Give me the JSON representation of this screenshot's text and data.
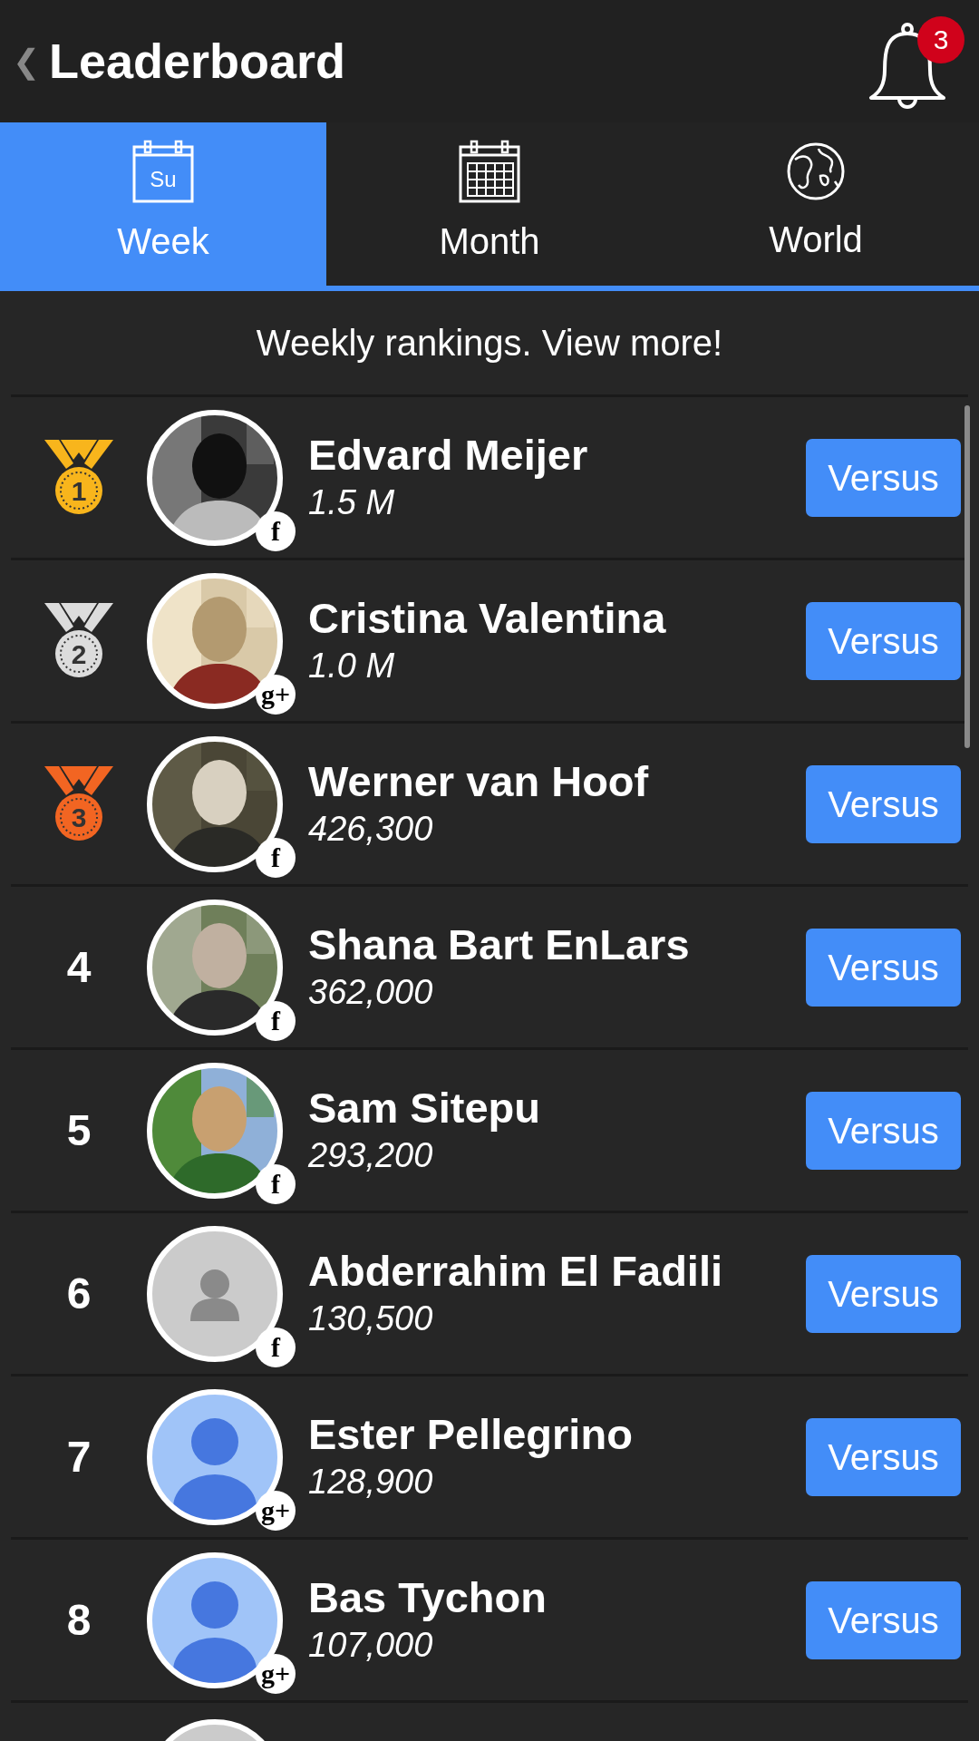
{
  "header": {
    "back": "❮",
    "title": "Leaderboard",
    "notification_count": "3"
  },
  "tabs": [
    {
      "label": "Week",
      "kind": "week",
      "icon_text": "Su",
      "selected": true
    },
    {
      "label": "Month",
      "kind": "month",
      "selected": false
    },
    {
      "label": "World",
      "kind": "globe",
      "selected": false
    }
  ],
  "subtitle": "Weekly rankings. View more!",
  "rows": [
    {
      "rank": "1",
      "kind": "medal",
      "color": "#f8b51c",
      "network": "f",
      "name": "Edvard Meijer",
      "score": "1.5 M",
      "button": "Versus"
    },
    {
      "rank": "2",
      "kind": "medal",
      "color": "#dcdcdc",
      "network": "g+",
      "name": "Cristina Valentina",
      "score": "1.0 M",
      "button": "Versus"
    },
    {
      "rank": "3",
      "kind": "medal",
      "color": "#f26522",
      "network": "f",
      "name": "Werner van Hoof",
      "score": "426,300",
      "button": "Versus"
    },
    {
      "rank": "4",
      "kind": "number",
      "network": "f",
      "name": "Shana Bart EnLars",
      "score": "362,000",
      "button": "Versus"
    },
    {
      "rank": "5",
      "kind": "number",
      "network": "f",
      "name": "Sam Sitepu",
      "score": "293,200",
      "button": "Versus"
    },
    {
      "rank": "6",
      "kind": "number",
      "avatar": {
        "kind": "silhouette"
      },
      "network": "f",
      "name": "Abderrahim El Fadili",
      "score": "130,500",
      "button": "Versus"
    },
    {
      "rank": "7",
      "kind": "number",
      "avatar": {
        "kind": "blue-person"
      },
      "network": "g+",
      "name": "Ester Pellegrino",
      "score": "128,900",
      "button": "Versus"
    },
    {
      "rank": "8",
      "kind": "number",
      "avatar": {
        "kind": "blue-person"
      },
      "network": "g+",
      "name": "Bas Tychon",
      "score": "107,000",
      "button": "Versus"
    },
    {
      "avatar": {
        "kind": "silhouette"
      }
    }
  ]
}
